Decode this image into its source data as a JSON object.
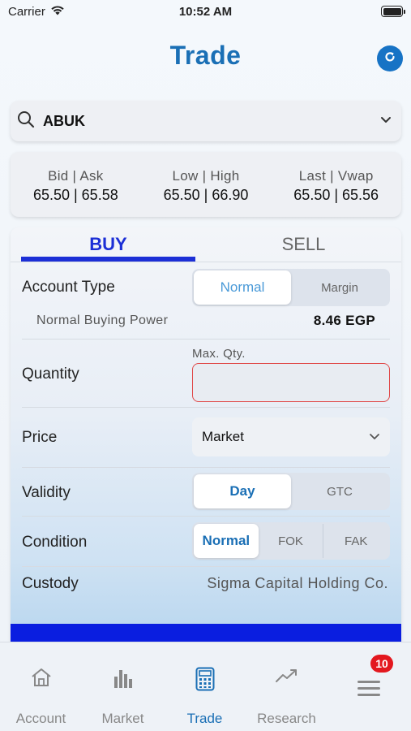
{
  "status_bar": {
    "carrier": "Carrier",
    "time": "10:52 AM"
  },
  "header": {
    "title": "Trade"
  },
  "search": {
    "symbol": "ABUK"
  },
  "quote": {
    "bid_ask_label": "Bid | Ask",
    "bid_ask_value": "65.50 | 65.58",
    "low_high_label": "Low | High",
    "low_high_value": "65.50 | 66.90",
    "last_vwap_label": "Last | Vwap",
    "last_vwap_value": "65.50 | 65.56"
  },
  "order": {
    "tabs": {
      "buy": "BUY",
      "sell": "SELL",
      "active": "BUY"
    },
    "account_type": {
      "label": "Account Type",
      "options": [
        "Normal",
        "Margin"
      ],
      "selected": "Normal"
    },
    "buying_power": {
      "label": "Normal Buying Power",
      "value": "8.46  EGP"
    },
    "quantity": {
      "label": "Quantity",
      "hint": "Max. Qty.",
      "value": ""
    },
    "price": {
      "label": "Price",
      "selected": "Market"
    },
    "validity": {
      "label": "Validity",
      "options": [
        "Day",
        "GTC"
      ],
      "selected": "Day"
    },
    "condition": {
      "label": "Condition",
      "options": [
        "Normal",
        "FOK",
        "FAK"
      ],
      "selected": "Normal"
    },
    "custody": {
      "label": "Custody",
      "value": "Sigma Capital Holding Co."
    }
  },
  "bottom_nav": {
    "items": [
      "Account",
      "Market",
      "Trade",
      "Research"
    ],
    "active": "Trade",
    "menu_badge": "10"
  },
  "colors": {
    "brand_blue": "#1a6fb5",
    "buy_blue": "#1c2fd6",
    "submit_blue": "#0a1ee0",
    "error_red": "#e04848",
    "badge_red": "#e3181f"
  }
}
